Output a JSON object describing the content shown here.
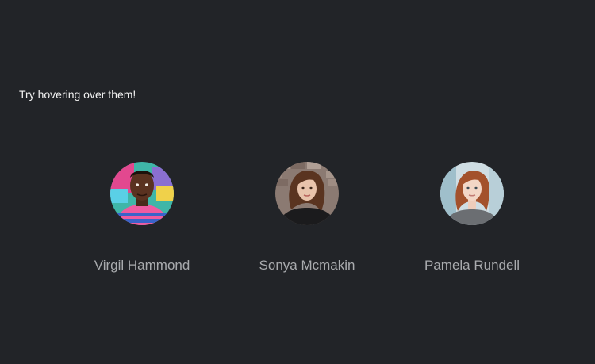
{
  "hint": "Try hovering over them!",
  "people": [
    {
      "name": "Virgil Hammond",
      "avatar": "portrait-man-graffiti-wall"
    },
    {
      "name": "Sonya Mcmakin",
      "avatar": "portrait-woman-brick-wall"
    },
    {
      "name": "Pamela Rundell",
      "avatar": "portrait-woman-light-background"
    }
  ],
  "colors": {
    "background": "#222428",
    "hint_text": "#f2f2f2",
    "name_text": "#a9abae"
  }
}
